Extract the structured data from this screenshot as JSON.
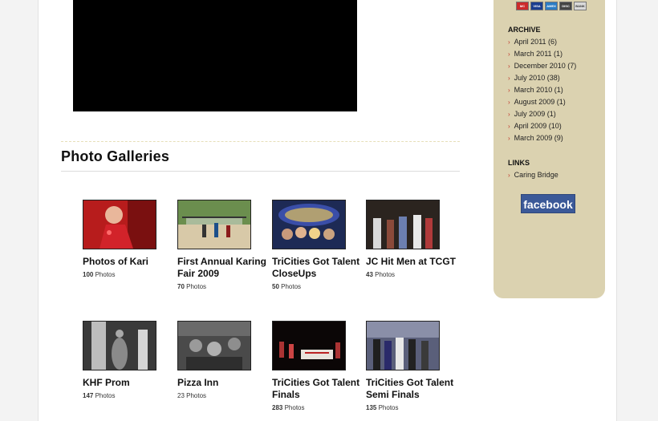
{
  "section_title": "Photo Galleries",
  "galleries": [
    {
      "title": "Photos of Kari",
      "count": "100",
      "count_label": "Photos",
      "bold_count": true
    },
    {
      "title": "First Annual Karing Fair 2009",
      "count": "70",
      "count_label": "Photos",
      "bold_count": true
    },
    {
      "title": "TriCities Got Talent CloseUps",
      "count": "50",
      "count_label": "Photos",
      "bold_count": true
    },
    {
      "title": "JC Hit Men at TCGT",
      "count": "43",
      "count_label": "Photos",
      "bold_count": true
    },
    {
      "title": "KHF Prom",
      "count": "147",
      "count_label": "Photos",
      "bold_count": true
    },
    {
      "title": "Pizza Inn",
      "count": "23",
      "count_label": "Photos",
      "bold_count": false
    },
    {
      "title": "TriCities Got Talent Finals",
      "count": "283",
      "count_label": "Photos",
      "bold_count": true
    },
    {
      "title": "TriCities Got Talent Semi Finals",
      "count": "135",
      "count_label": "Photos",
      "bold_count": true
    }
  ],
  "sidebar": {
    "payment_icons": [
      "MC",
      "VISA",
      "AMEX",
      "DISC",
      "BANK"
    ],
    "archive_heading": "ARCHIVE",
    "archive": [
      "April 2011 (6)",
      "March 2011 (1)",
      "December 2010 (7)",
      "July 2010 (38)",
      "March 2010 (1)",
      "August 2009 (1)",
      "July 2009 (1)",
      "April 2009 (10)",
      "March 2009 (9)"
    ],
    "links_heading": "LINKS",
    "links": [
      "Caring Bridge"
    ],
    "facebook_label": "facebook"
  },
  "colors": {
    "sidebar_bg": "#dbd2b0",
    "arrow": "#c0392b",
    "facebook": "#3b5998"
  }
}
